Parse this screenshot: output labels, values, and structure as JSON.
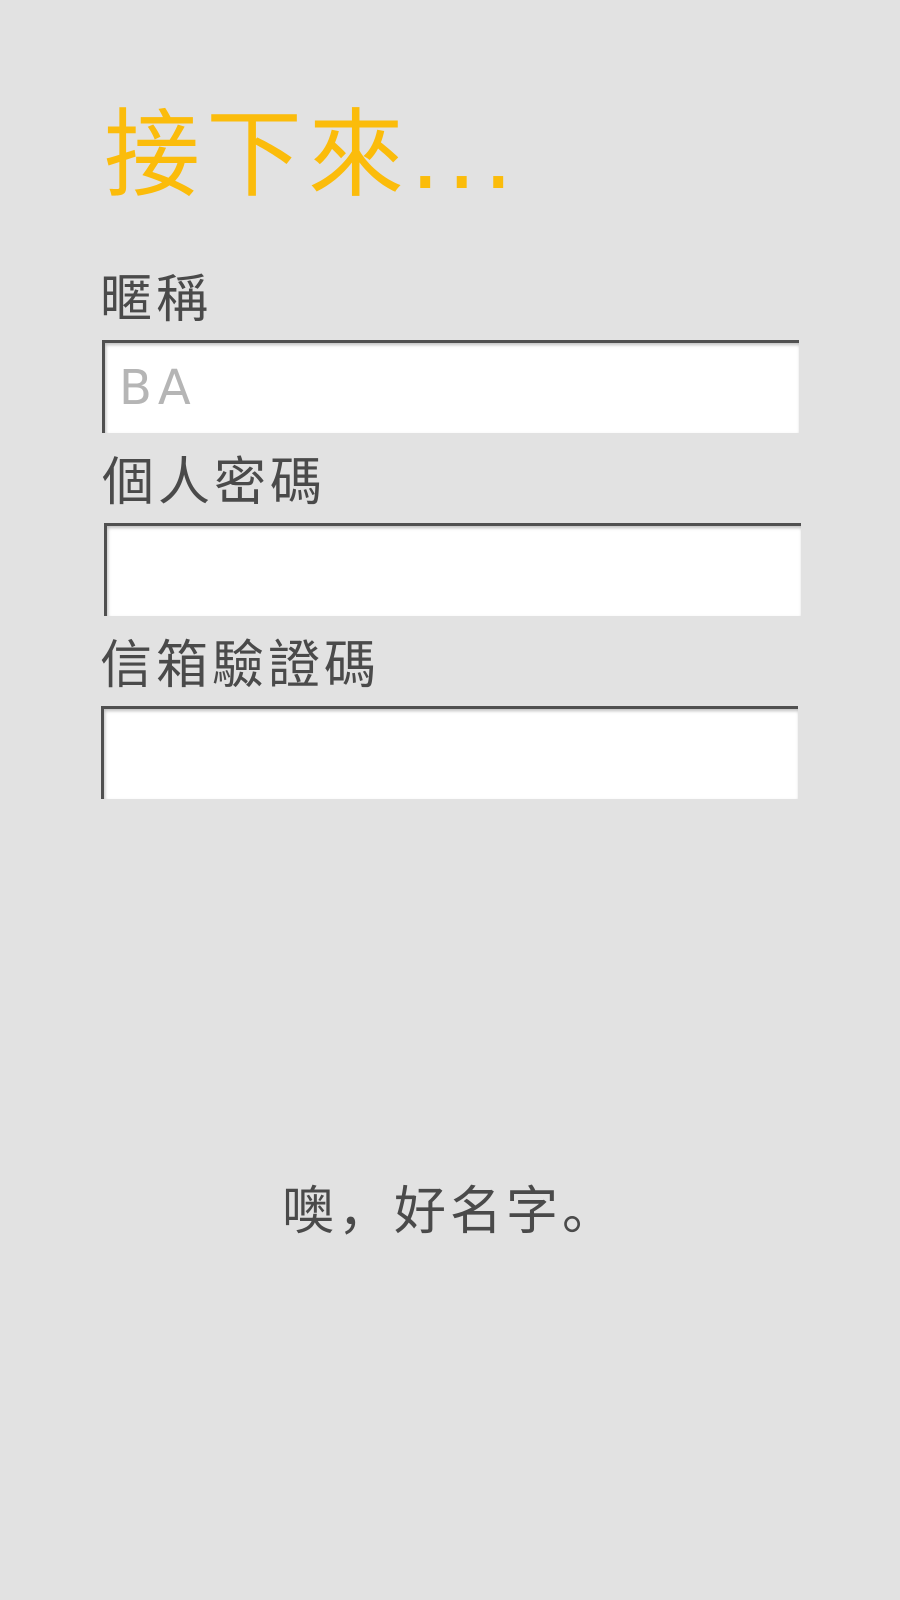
{
  "header": {
    "title": "接下來..."
  },
  "form": {
    "nickname": {
      "label": "暱稱",
      "value": "",
      "placeholder": "BA"
    },
    "password": {
      "label": "個人密碼",
      "value": "",
      "placeholder": ""
    },
    "email_code": {
      "label": "信箱驗證碼",
      "value": "",
      "placeholder": ""
    }
  },
  "message": "噢，好名字。",
  "colors": {
    "background": "#e2e2e2",
    "accent": "#fbbc0b",
    "text": "#4a4a4a",
    "placeholder": "#b5b5b5"
  }
}
